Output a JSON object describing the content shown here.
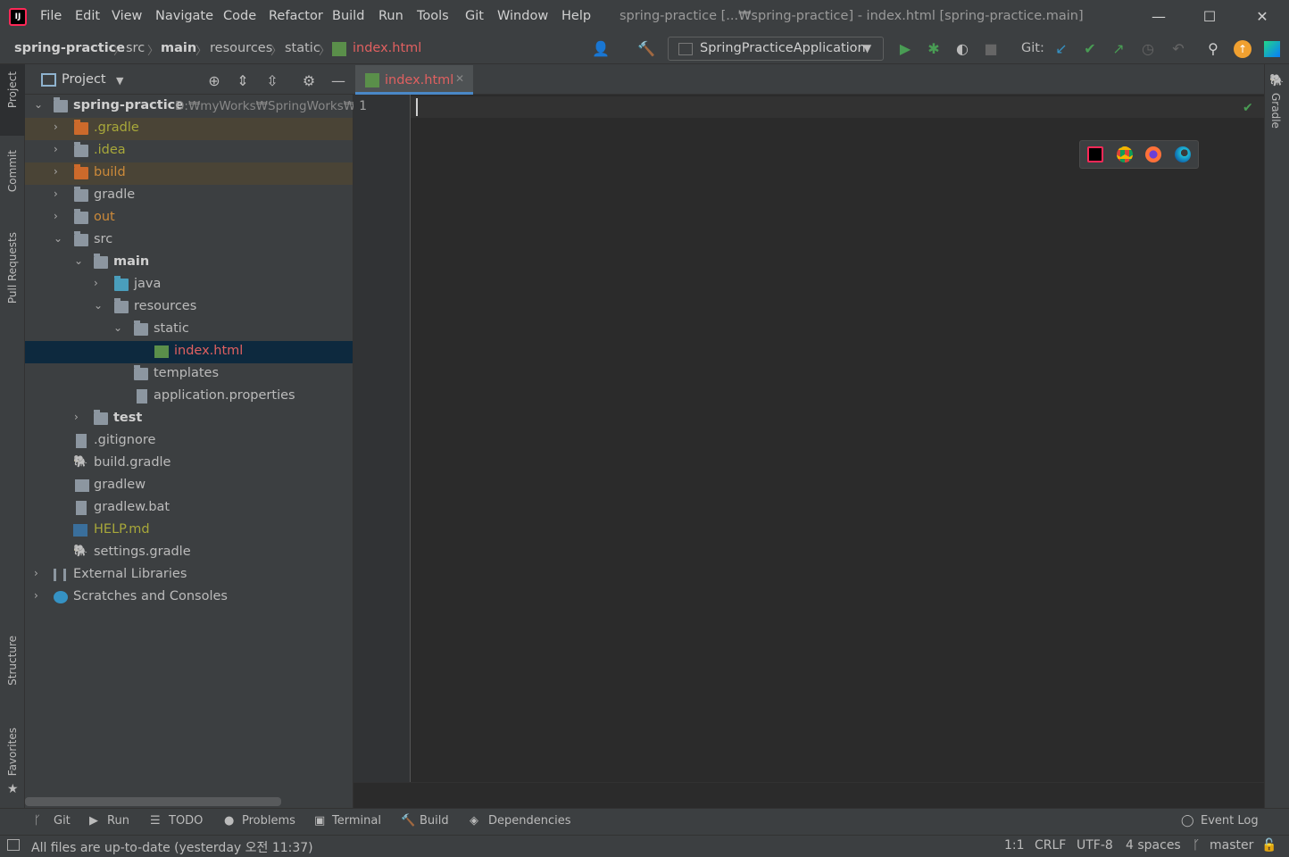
{
  "titlebar": {
    "menu": [
      "File",
      "Edit",
      "View",
      "Navigate",
      "Code",
      "Refactor",
      "Build",
      "Run",
      "Tools",
      "Git",
      "Window",
      "Help"
    ],
    "window_title": "spring-practice [...₩spring-practice] - index.html [spring-practice.main]"
  },
  "navbar": {
    "breadcrumbs": [
      "spring-practice",
      "src",
      "main",
      "resources",
      "static",
      "index.html"
    ],
    "run_config": "SpringPracticeApplication",
    "git_label": "Git:"
  },
  "left_stripe": [
    "Project",
    "Commit",
    "Pull Requests",
    "Structure",
    "Favorites"
  ],
  "right_stripe": [
    "Gradle"
  ],
  "project": {
    "title": "Project",
    "tree": [
      {
        "label": "spring-practice",
        "path": "D:₩myWorks₩SpringWorks₩s"
      },
      {
        "label": ".gradle"
      },
      {
        "label": ".idea"
      },
      {
        "label": "build"
      },
      {
        "label": "gradle"
      },
      {
        "label": "out"
      },
      {
        "label": "src"
      },
      {
        "label": "main"
      },
      {
        "label": "java"
      },
      {
        "label": "resources"
      },
      {
        "label": "static"
      },
      {
        "label": "index.html"
      },
      {
        "label": "templates"
      },
      {
        "label": "application.properties"
      },
      {
        "label": "test"
      },
      {
        "label": ".gitignore"
      },
      {
        "label": "build.gradle"
      },
      {
        "label": "gradlew"
      },
      {
        "label": "gradlew.bat"
      },
      {
        "label": "HELP.md"
      },
      {
        "label": "settings.gradle"
      },
      {
        "label": "External Libraries"
      },
      {
        "label": "Scratches and Consoles"
      }
    ]
  },
  "editor": {
    "tab_label": "index.html",
    "line_number": "1"
  },
  "toolwindows": [
    "Git",
    "Run",
    "TODO",
    "Problems",
    "Terminal",
    "Build",
    "Dependencies"
  ],
  "event_log": "Event Log",
  "status": {
    "message": "All files are up-to-date (yesterday 오전 11:37)",
    "position": "1:1",
    "line_sep": "CRLF",
    "encoding": "UTF-8",
    "indent": "4 spaces",
    "branch": "master"
  }
}
